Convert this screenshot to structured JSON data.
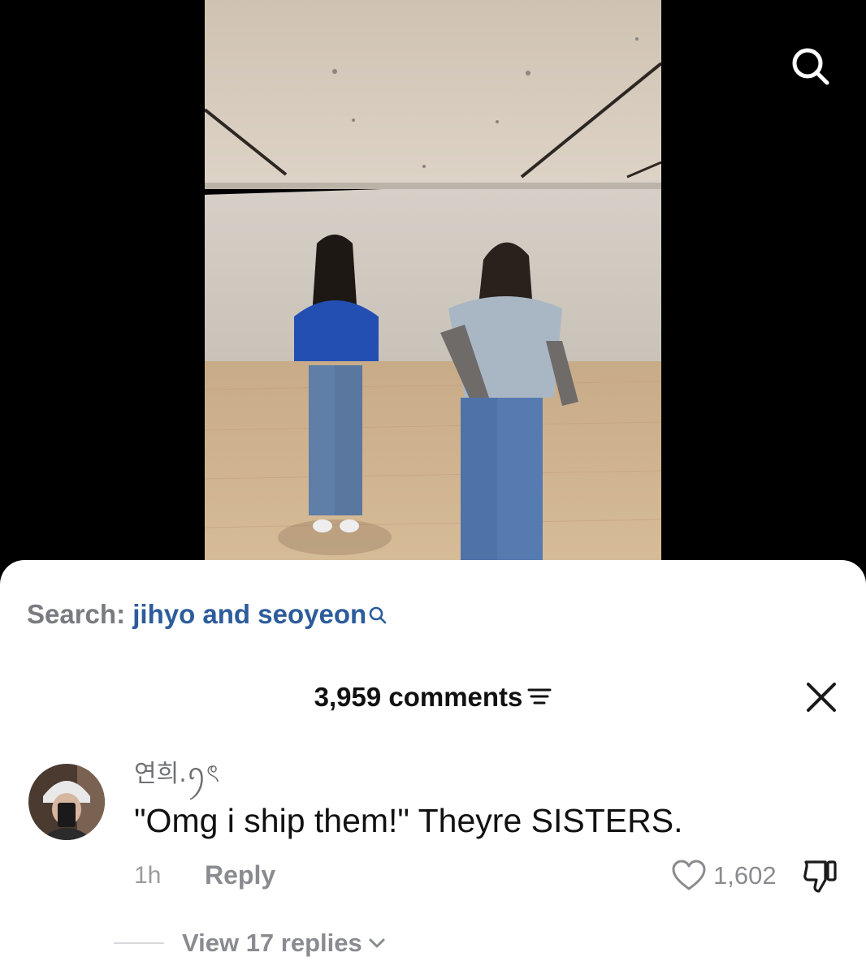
{
  "search": {
    "prefix": "Search:",
    "term": "jihyo and seoyeon"
  },
  "comments_header": {
    "count_label": "3,959 comments"
  },
  "comment": {
    "username": "연희.ꪆৎ",
    "text": "\"Omg i ship them!\" Theyre SISTERS.",
    "time": "1h",
    "reply_label": "Reply",
    "like_count": "1,602",
    "view_replies_label": "View 17 replies"
  },
  "icons": {
    "top_search": "search-icon",
    "search_inline": "search-icon",
    "sort": "filter-icon",
    "close": "close-icon",
    "like": "heart-icon",
    "dislike": "thumbs-down-icon",
    "expand": "chevron-down-icon"
  },
  "colors": {
    "search_term": "#2c5c9b",
    "secondary_text": "#8a8b90",
    "sheet_bg": "#ffffff",
    "page_bg": "#000000"
  }
}
